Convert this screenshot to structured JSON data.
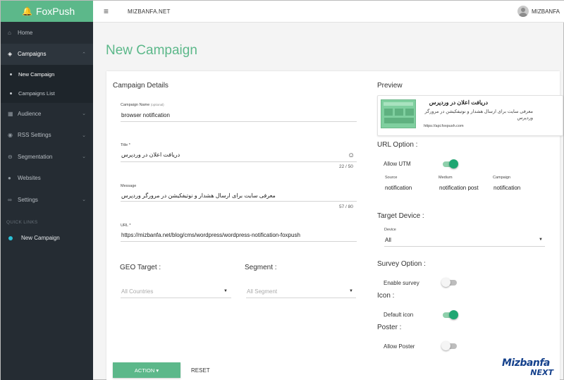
{
  "brand": {
    "name": "FoxPush"
  },
  "sidebar": {
    "items": [
      {
        "label": "Home",
        "icon": "home-icon"
      },
      {
        "label": "Campaigns",
        "icon": "layers-icon"
      },
      {
        "label": "Audience",
        "icon": "audience-icon"
      },
      {
        "label": "RSS Settings",
        "icon": "rss-icon"
      },
      {
        "label": "Segmentation",
        "icon": "segmentation-icon"
      },
      {
        "label": "Websites",
        "icon": "globe-icon"
      },
      {
        "label": "Settings",
        "icon": "link-icon"
      }
    ],
    "campaigns_sub": [
      {
        "label": "New Campaign"
      },
      {
        "label": "Campaigns List"
      }
    ],
    "quick_links_heading": "QUICK LINKS",
    "quick_links": [
      {
        "label": "New Campaign"
      }
    ]
  },
  "topbar": {
    "site": "MIZBANFA.NET",
    "user": "MIZBANFA"
  },
  "page": {
    "title": "New Campaign"
  },
  "details": {
    "heading": "Campaign Details",
    "campaign_name_label": "Campaign Name",
    "campaign_name_optional": "(optional)",
    "campaign_name_value": "browser notification",
    "title_label": "Title *",
    "title_value": "دریافت اعلان در وردپرس",
    "title_counter": "22 / 50",
    "message_label": "Message",
    "message_value": "معرفی سایت برای ارسال هشدار و نوتیفکیشن در مرورگر وردپرس",
    "message_counter": "57 / 80",
    "url_label": "URL *",
    "url_value": "https://mizbanfa.net/blog/cms/wordpress/wordpress-notification-foxpush"
  },
  "geo": {
    "heading": "GEO Target :",
    "placeholder": "All Countries"
  },
  "segment": {
    "heading": "Segment :",
    "placeholder": "All Segment"
  },
  "preview": {
    "heading": "Preview",
    "title": "دریافت اعلان در وردپرس",
    "message": "معرفی سایت برای ارسال هشدار و نوتیفکیشن در مرورگر وردپرس",
    "url": "https://api.foxpush.com"
  },
  "url_option": {
    "heading": "URL Option :",
    "allow_utm_label": "Allow UTM",
    "allow_utm": true,
    "source_label": "Source",
    "source_value": "notification",
    "medium_label": "Medium",
    "medium_value": "notification post",
    "campaign_label": "Campaign",
    "campaign_value": "notification"
  },
  "target_device": {
    "heading": "Target Device :",
    "device_label": "Device",
    "device_value": "All"
  },
  "survey": {
    "heading": "Survey Option :",
    "enable_label": "Enable survey",
    "enabled": false
  },
  "icon_opt": {
    "heading": "Icon :",
    "default_label": "Default icon",
    "enabled": true
  },
  "poster": {
    "heading": "Poster :",
    "allow_label": "Allow Poster",
    "enabled": false
  },
  "actions": {
    "action_label": "ACTION ▾",
    "reset_label": "RESET"
  },
  "watermark": {
    "line1": "Mizbanfa",
    "line2": "NEXT"
  },
  "colors": {
    "accent": "#5cb88a",
    "sidebar_bg": "#252c33",
    "toggle_on": "#1fa672",
    "quick_dot": "#2bc0d6"
  }
}
